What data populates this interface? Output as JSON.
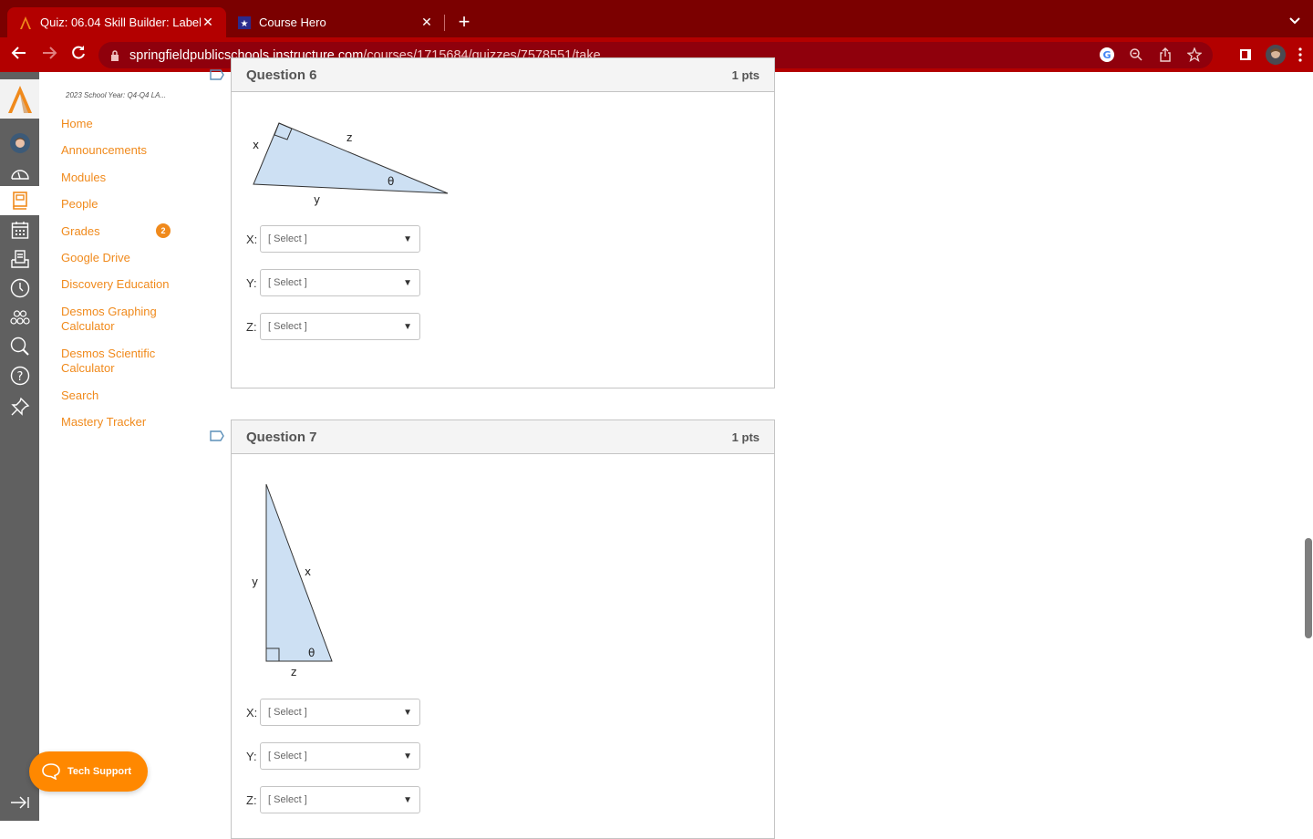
{
  "browser": {
    "tabs": [
      {
        "title": "Quiz: 06.04 Skill Builder: Label",
        "favicon": "canvas-logo-icon",
        "active": true
      },
      {
        "title": "Course Hero",
        "favicon": "course-hero-icon",
        "active": false
      }
    ],
    "new_tab_label": "+",
    "url_host": "springfieldpublicschools.instructure.com",
    "url_path": "/courses/1715684/quizzes/7578551/take"
  },
  "global_nav": {
    "items": [
      {
        "name": "account",
        "icon": "avatar-icon"
      },
      {
        "name": "dashboard",
        "icon": "dashboard-icon"
      },
      {
        "name": "courses",
        "icon": "courses-icon",
        "active": true
      },
      {
        "name": "calendar",
        "icon": "calendar-icon"
      },
      {
        "name": "inbox",
        "icon": "inbox-icon"
      },
      {
        "name": "history",
        "icon": "clock-icon"
      },
      {
        "name": "groups",
        "icon": "groups-icon"
      },
      {
        "name": "search",
        "icon": "search-icon"
      },
      {
        "name": "help",
        "icon": "help-icon"
      },
      {
        "name": "pin",
        "icon": "pin-icon"
      }
    ]
  },
  "course_nav": {
    "term": "2023 School Year: Q4-Q4 LA...",
    "links": [
      {
        "label": "Home"
      },
      {
        "label": "Announcements"
      },
      {
        "label": "Modules"
      },
      {
        "label": "People"
      },
      {
        "label": "Grades",
        "badge": "2"
      },
      {
        "label": "Google Drive"
      },
      {
        "label": "Discovery Education"
      },
      {
        "label": "Desmos Graphing Calculator"
      },
      {
        "label": "Desmos Scientific Calculator"
      },
      {
        "label": "Search"
      },
      {
        "label": "Mastery Tracker"
      }
    ]
  },
  "tech_support": {
    "label": "Tech Support"
  },
  "questions": [
    {
      "title": "Question 6",
      "points": "1 pts",
      "figure_labels": {
        "x": "x",
        "y": "y",
        "z": "z",
        "theta": "θ"
      },
      "answers": [
        {
          "label": "X:",
          "value": "[ Select ]"
        },
        {
          "label": "Y:",
          "value": "[ Select ]"
        },
        {
          "label": "Z:",
          "value": "[ Select ]"
        }
      ]
    },
    {
      "title": "Question 7",
      "points": "1 pts",
      "figure_labels": {
        "x": "x",
        "y": "y",
        "z": "z",
        "theta": "θ"
      },
      "answers": [
        {
          "label": "X:",
          "value": "[ Select ]"
        },
        {
          "label": "Y:",
          "value": "[ Select ]"
        },
        {
          "label": "Z:",
          "value": "[ Select ]"
        }
      ]
    }
  ],
  "colors": {
    "accent": "#f08a1c",
    "chrome_dark": "#7b0000",
    "chrome": "#b30000",
    "triangle_fill": "#cde0f3"
  }
}
